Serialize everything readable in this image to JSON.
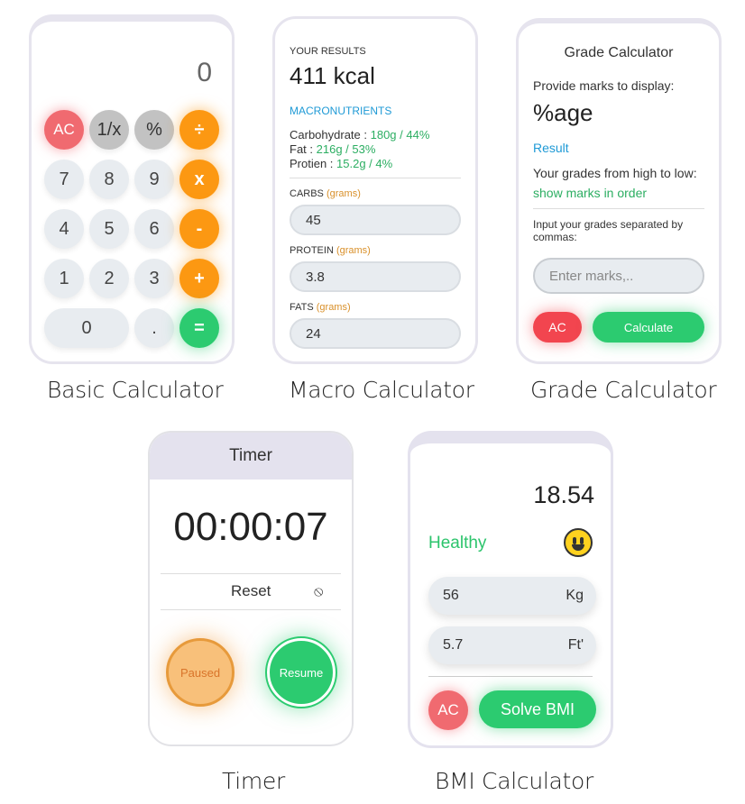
{
  "basic": {
    "display": "0",
    "buttons": [
      {
        "label": "AC",
        "kind": "ac"
      },
      {
        "label": "1/x",
        "kind": "gray"
      },
      {
        "label": "%",
        "kind": "gray"
      },
      {
        "label": "÷",
        "kind": "op"
      },
      {
        "label": "7",
        "kind": "num"
      },
      {
        "label": "8",
        "kind": "num"
      },
      {
        "label": "9",
        "kind": "num"
      },
      {
        "label": "x",
        "kind": "op"
      },
      {
        "label": "4",
        "kind": "num"
      },
      {
        "label": "5",
        "kind": "num"
      },
      {
        "label": "6",
        "kind": "num"
      },
      {
        "label": "-",
        "kind": "op"
      },
      {
        "label": "1",
        "kind": "num"
      },
      {
        "label": "2",
        "kind": "num"
      },
      {
        "label": "3",
        "kind": "num"
      },
      {
        "label": "+",
        "kind": "op"
      },
      {
        "label": "0",
        "kind": "num"
      },
      {
        "label": ".",
        "kind": "num"
      },
      {
        "label": "=",
        "kind": "eq"
      }
    ],
    "caption": "Basic Calculator"
  },
  "macro": {
    "results_label": "YOUR RESULTS",
    "kcal": "411 kcal",
    "macros_title": "MACRONUTRIENTS",
    "carb_label": "Carbohydrate : ",
    "carb_value": "180g / 44%",
    "fat_label": "Fat : ",
    "fat_value": "216g / 53%",
    "protein_label": "Protien : ",
    "protein_value": "15.2g / 4%",
    "carbs_field_label": "CARBS ",
    "protein_field_label": "PROTEIN ",
    "fats_field_label": "FATS ",
    "unit": "(grams)",
    "carbs_value": "45",
    "protein_input_value": "3.8",
    "fats_value": "24",
    "caption": "Macro Calculator"
  },
  "grade": {
    "title": "Grade Calculator",
    "provide_text": "Provide marks to display:",
    "big": "%age",
    "result_label": "Result",
    "grades_text": "Your grades from high to low:",
    "show_marks": "show marks in order",
    "input_instruction": "Input your grades separated by commas:",
    "input_placeholder": "Enter marks,..",
    "ac_label": "AC",
    "calc_label": "Calculate",
    "caption": "Grade Calculator"
  },
  "timer": {
    "title": "Timer",
    "time": "00:00:07",
    "reset_label": "Reset",
    "reset_icon": "⦸",
    "paused_label": "Paused",
    "resume_label": "Resume",
    "caption": "Timer"
  },
  "bmi": {
    "value": "18.54",
    "status": "Healthy",
    "weight": "56",
    "weight_unit": "Kg",
    "height": "5.7",
    "height_unit": "Ft'",
    "ac_label": "AC",
    "solve_label": "Solve BMI",
    "caption": "BMI Calculator"
  }
}
